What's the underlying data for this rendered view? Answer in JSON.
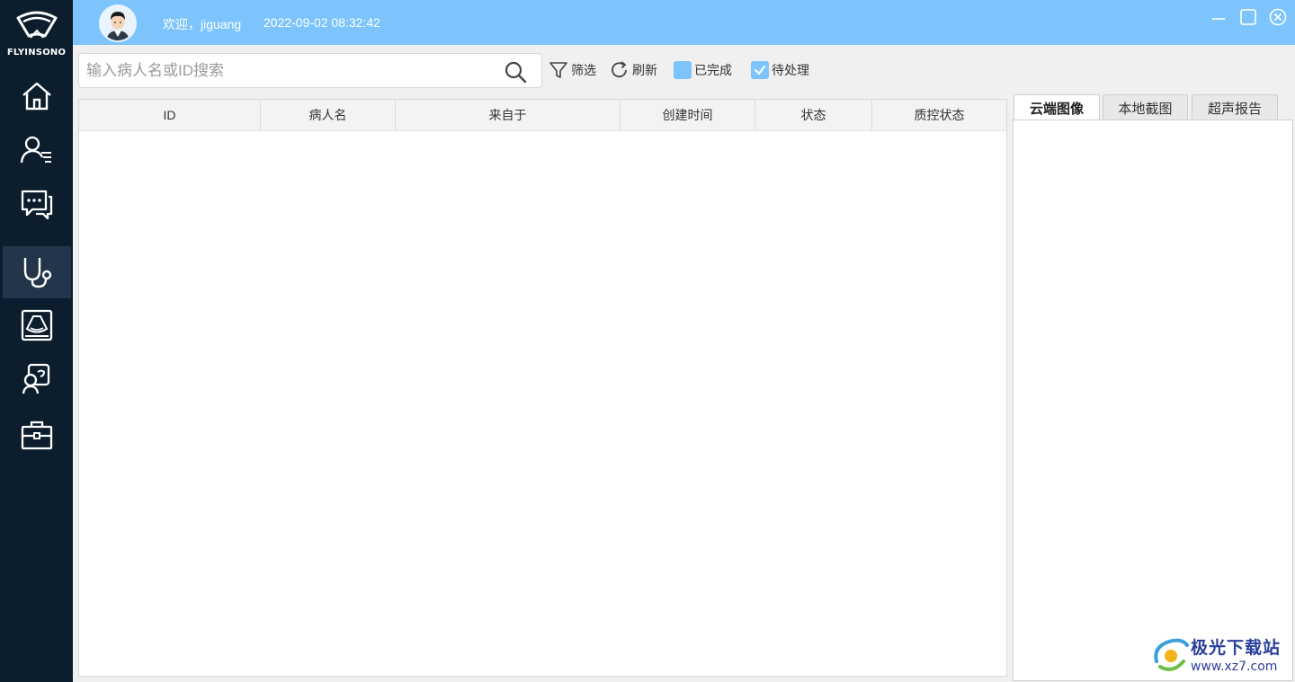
{
  "brand": {
    "name": "FLYINSONO"
  },
  "sidebar": {
    "items": [
      {
        "icon": "home-icon"
      },
      {
        "icon": "patient-list-icon"
      },
      {
        "icon": "chat-icon"
      },
      {
        "icon": "stethoscope-icon",
        "active": true
      },
      {
        "icon": "ultrasound-icon"
      },
      {
        "icon": "consultation-icon"
      },
      {
        "icon": "toolbox-icon"
      }
    ]
  },
  "header": {
    "welcome": "欢迎，jiguang",
    "datetime": "2022-09-02 08:32:42"
  },
  "toolbar": {
    "search_placeholder": "输入病人名或ID搜索",
    "filter_label": "筛选",
    "refresh_label": "刷新",
    "completed_label": "已完成",
    "pending_label": "待处理",
    "completed_checked": false,
    "pending_checked": true
  },
  "table": {
    "columns": [
      "ID",
      "病人名",
      "来自于",
      "创建时间",
      "状态",
      "质控状态"
    ],
    "rows": []
  },
  "right_panel": {
    "tabs": [
      "云端图像",
      "本地截图",
      "超声报告"
    ],
    "active_tab": 0
  },
  "watermark": {
    "title": "极光下载站",
    "url": "www.xz7.com"
  },
  "colors": {
    "accent": "#7cc4fb",
    "sidebar": "#0c1d2d",
    "sidebar_active": "#22354a"
  }
}
